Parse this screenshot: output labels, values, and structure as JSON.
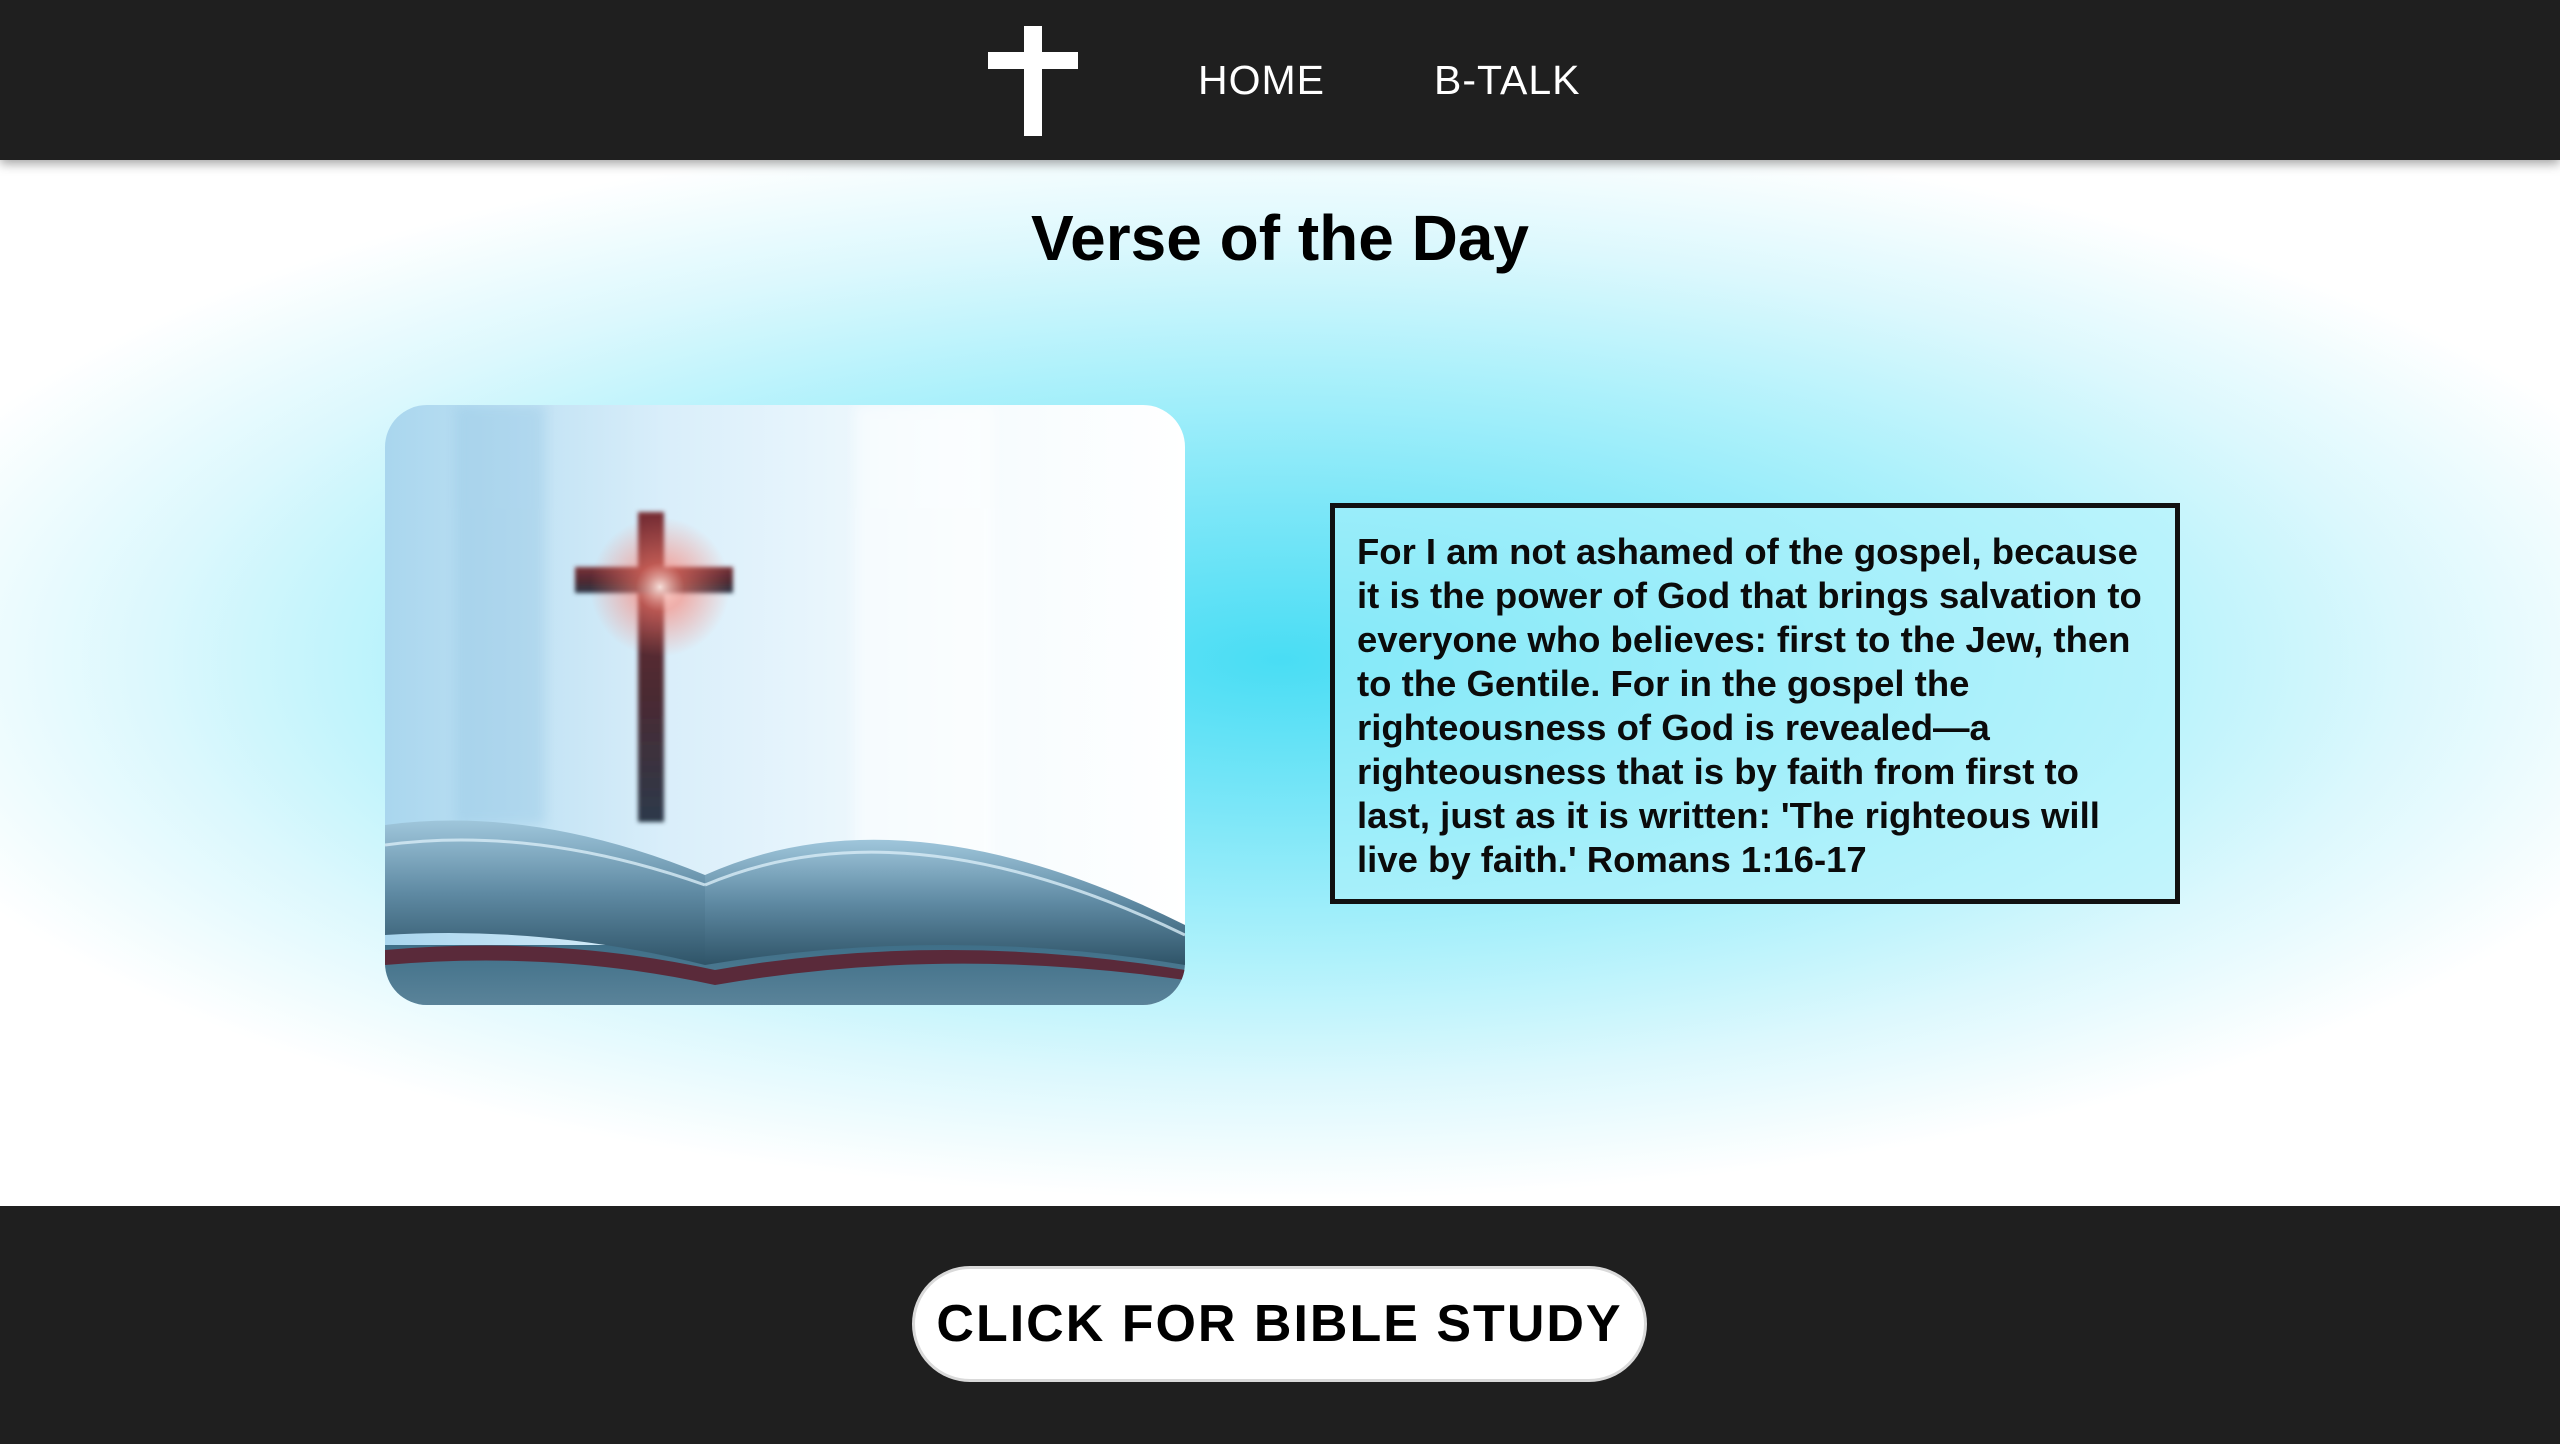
{
  "header": {
    "logo_icon": "cross-icon",
    "nav": [
      {
        "label": "HOME"
      },
      {
        "label": "B-TALK"
      }
    ]
  },
  "main": {
    "title": "Verse of the Day",
    "image_icon": "cross-on-open-bible-photo",
    "verse": "For I am not ashamed of the gospel, because it is the power of God that brings salvation to everyone who believes: first to the Jew, then to the Gentile. For in the gospel the righteousness of God is revealed—a righteousness that is by faith from first to last, just as it is written: 'The righteous will live by faith.' Romans 1:16-17"
  },
  "footer": {
    "button_label": "CLICK FOR BIBLE STUDY"
  },
  "colors": {
    "bar_background": "#1f1f1f",
    "glow_center": "#49ddf4",
    "text": "#000000",
    "button_background": "#ffffff"
  }
}
